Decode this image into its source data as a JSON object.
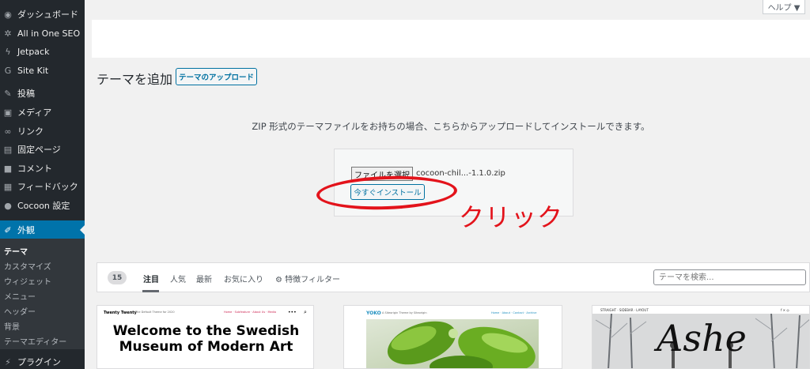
{
  "sidebar": {
    "items": [
      {
        "label": "ダッシュボード",
        "icon": "dashboard-icon",
        "glyph": "◉"
      },
      {
        "label": "All in One SEO",
        "icon": "gear-icon",
        "glyph": "✲"
      },
      {
        "label": "Jetpack",
        "icon": "jetpack-icon",
        "glyph": "ϟ"
      },
      {
        "label": "Site Kit",
        "icon": "google-g-icon",
        "glyph": "G"
      },
      {
        "label": "投稿",
        "icon": "pin-icon",
        "glyph": "✎"
      },
      {
        "label": "メディア",
        "icon": "media-icon",
        "glyph": "▣"
      },
      {
        "label": "リンク",
        "icon": "link-icon",
        "glyph": "∞"
      },
      {
        "label": "固定ページ",
        "icon": "page-icon",
        "glyph": "▤"
      },
      {
        "label": "コメント",
        "icon": "comment-icon",
        "glyph": "■"
      },
      {
        "label": "フィードバック",
        "icon": "feedback-icon",
        "glyph": "▦"
      },
      {
        "label": "Cocoon 設定",
        "icon": "cocoon-icon",
        "glyph": "●"
      },
      {
        "label": "外観",
        "icon": "brush-icon",
        "glyph": "✐"
      }
    ],
    "submenu": [
      "テーマ",
      "カスタマイズ",
      "ウィジェット",
      "メニュー",
      "ヘッダー",
      "背景",
      "テーマエディター"
    ],
    "bottom_item": {
      "label": "プラグイン",
      "icon": "plugin-icon",
      "glyph": "⚡"
    }
  },
  "header": {
    "help_label": "ヘルプ ▼"
  },
  "page": {
    "title": "テーマを追加",
    "upload_button": "テーマのアップロード",
    "upload_description": "ZIP 形式のテーマファイルをお持ちの場合、こちらからアップロードしてインストールできます。",
    "file_button": "ファイルを選択",
    "file_name": "cocoon-chil...-1.1.0.zip",
    "install_button": "今すぐインストール",
    "annotation": "クリック",
    "annotation_color": "#e3131b"
  },
  "filter": {
    "count": "15",
    "tabs": [
      "注目",
      "人気",
      "最新",
      "お気に入り"
    ],
    "feature_filter": "特徴フィルター",
    "search_placeholder": "テーマを検索..."
  },
  "themes": [
    {
      "name": "Twenty Twenty",
      "tagline": "The Default Theme for 2020",
      "nav": "Home · Subfeature · About Us · Media",
      "headline": "Welcome to the Swedish Museum of Modern Art"
    },
    {
      "logo": "YOKO",
      "tagline": "A Siteorigin Theme by Siteorigin",
      "nav": "Home · About · Contact · Archive"
    },
    {
      "top": "STRAIGHT · SIDEBAR · LAYOUT",
      "social": "f ✕ ◎",
      "title": "Ashe"
    }
  ],
  "colors": {
    "sidebar_bg": "#23282d",
    "accent": "#0073aa",
    "page_bg": "#f1f1f1"
  }
}
